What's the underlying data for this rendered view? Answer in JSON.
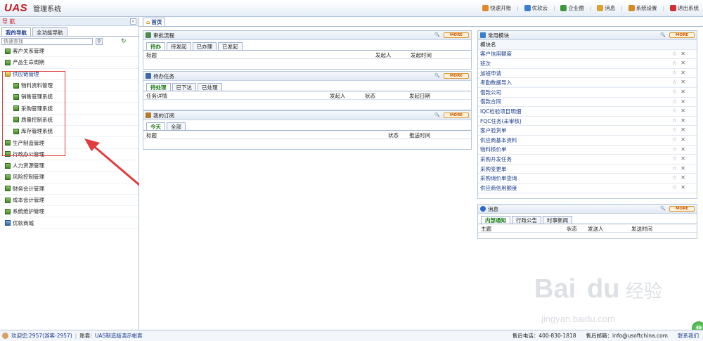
{
  "header": {
    "logo": "UAS",
    "system_name": "管理系统",
    "links": [
      {
        "label": "快速开账",
        "icon": "quick-start-icon",
        "color": "#e08a2a"
      },
      {
        "label": "优软云",
        "icon": "cloud-icon",
        "color": "#3a7fd0"
      },
      {
        "label": "企业圈",
        "icon": "circle-icon",
        "color": "#3a9a3a"
      },
      {
        "label": "消息",
        "icon": "message-icon",
        "color": "#e0a030"
      },
      {
        "label": "系统设置",
        "icon": "settings-icon",
        "color": "#d88a20"
      },
      {
        "label": "退出系统",
        "icon": "exit-icon",
        "color": "#d03030"
      }
    ]
  },
  "sidebar": {
    "title": "导 航",
    "tabs": [
      "我的导航",
      "全功能导航"
    ],
    "search_placeholder": "快速查找",
    "items": [
      {
        "label": "客户关系管理"
      },
      {
        "label": "产品生命周期"
      },
      {
        "label": "供应链管理",
        "open": true
      },
      {
        "label": "物料资料管理",
        "sub": true
      },
      {
        "label": "销售管理系统",
        "sub": true
      },
      {
        "label": "采购管理系统",
        "sub": true
      },
      {
        "label": "质量控制系统",
        "sub": true
      },
      {
        "label": "库存管理系统",
        "sub": true
      },
      {
        "label": "生产制造管理"
      },
      {
        "label": "行政办公管理"
      },
      {
        "label": "人力资源管理"
      },
      {
        "label": "风险控制管理"
      },
      {
        "label": "财务会计管理"
      },
      {
        "label": "成本会计管理"
      },
      {
        "label": "系统维护管理"
      },
      {
        "label": "优软商城",
        "shop": true
      }
    ]
  },
  "content": {
    "home_tab": "首页",
    "more_label": "MORE",
    "approval": {
      "title": "审批流程",
      "tabs": [
        "待办",
        "待发起",
        "已办理",
        "已发起"
      ],
      "columns": [
        "标题",
        "发起人",
        "发起时间"
      ]
    },
    "tasks": {
      "title": "待办任务",
      "tabs": [
        "待处理",
        "已下达",
        "已处理"
      ],
      "columns": [
        "任务详情",
        "发起人",
        "状态",
        "发起日期"
      ]
    },
    "subscriptions": {
      "title": "我的订阅",
      "tabs": [
        "今天",
        "全部"
      ],
      "columns": [
        "标题",
        "状态",
        "推送时间"
      ]
    },
    "modules": {
      "title": "常用模块",
      "header": "模块名",
      "items": [
        "客户信用额度",
        "班次",
        "加班申请",
        "考勤数据导入",
        "借款公司",
        "借款合同",
        "IQC检验项目明细",
        "FQC任务(未审核)",
        "客户验货单",
        "供应商基本资料",
        "物料核价单",
        "采购开发任务",
        "采购变更单",
        "采购询价单查询",
        "供应商信用额度"
      ]
    },
    "news": {
      "title": "消息",
      "tabs": [
        "内部通知",
        "行政公告",
        "时事新闻"
      ],
      "columns": [
        "主题",
        "状态",
        "发送人",
        "发送时间"
      ]
    }
  },
  "status_bar": {
    "welcome": "欢迎您:2957(游客-2957)",
    "account_label": "账套:",
    "account": "UAS制造版演示帐套",
    "hotline": "售后电话：400-830-1818",
    "email": "售后邮箱：info@usoftchina.com",
    "contact": "联系我们"
  },
  "watermark": {
    "brand": "Baidu经验",
    "url": "jingyan.baidu.com"
  },
  "float_button": "49"
}
